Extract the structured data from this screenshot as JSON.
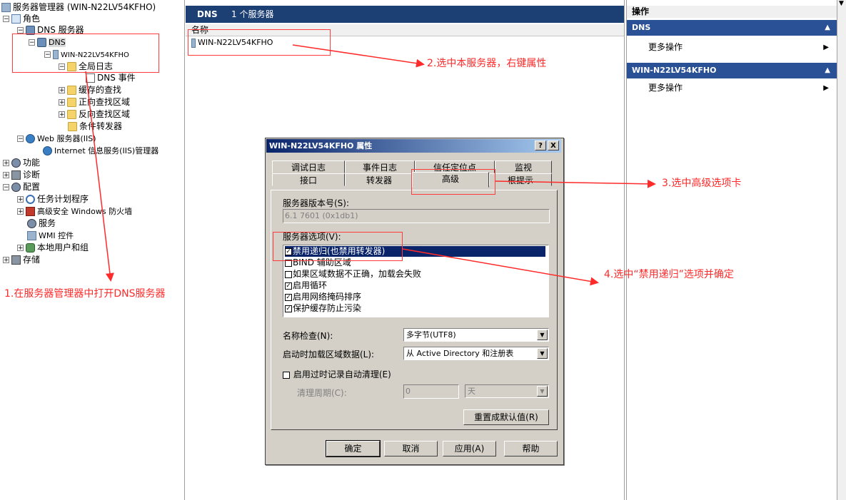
{
  "tree": {
    "root": "服务器管理器 (WIN-N22LV54KFHO)",
    "roles": "角色",
    "dns_server": "DNS 服务器",
    "dns": "DNS",
    "host": "WIN-N22LV54KFHO",
    "global_logs": "全局日志",
    "dns_events": "DNS 事件",
    "cached_lookups": "缓存的查找",
    "forward_zones": "正向查找区域",
    "reverse_zones": "反向查找区域",
    "conditional_forwarders": "条件转发器",
    "web_server": "Web 服务器(IIS)",
    "iis_manager": "Internet 信息服务(IIS)管理器",
    "features": "功能",
    "diagnostics": "诊断",
    "configuration": "配置",
    "task_scheduler": "任务计划程序",
    "firewall": "高级安全 Windows 防火墙",
    "services": "服务",
    "wmi": "WMI 控件",
    "local_users": "本地用户和组",
    "storage": "存储"
  },
  "center": {
    "header_name": "DNS",
    "header_count": "1 个服务器",
    "column_name": "名称",
    "server_row": "WIN-N22LV54KFHO"
  },
  "actions": {
    "title": "操作",
    "section1": "DNS",
    "more1": "更多操作",
    "section2": "WIN-N22LV54KFHO",
    "more2": "更多操作"
  },
  "dialog": {
    "title": "WIN-N22LV54KFHO 属性",
    "help_btn": "?",
    "close_btn": "X",
    "tabs_row1": [
      "调试日志",
      "事件日志",
      "信任定位点",
      "监视"
    ],
    "tabs_row2": [
      "接口",
      "转发器",
      "高级",
      "根提示"
    ],
    "version_label": "服务器版本号(S):",
    "version_value": "6.1 7601 (0x1db1)",
    "options_label": "服务器选项(V):",
    "options": [
      {
        "label": "禁用递归(也禁用转发器)",
        "checked": true
      },
      {
        "label": "BIND 辅助区域",
        "checked": false
      },
      {
        "label": "如果区域数据不正确，加载会失败",
        "checked": false
      },
      {
        "label": "启用循环",
        "checked": true
      },
      {
        "label": "启用网络掩码排序",
        "checked": true
      },
      {
        "label": "保护缓存防止污染",
        "checked": true
      }
    ],
    "name_check_label": "名称检查(N):",
    "name_check_value": "多字节(UTF8)",
    "load_label": "启动时加载区域数据(L):",
    "load_value": "从 Active Directory 和注册表",
    "scavenging_label": "启用过时记录自动清理(E)",
    "period_label": "清理周期(C):",
    "period_value": "0",
    "period_unit": "天",
    "reset_btn": "重置成默认值(R)",
    "ok_btn": "确定",
    "cancel_btn": "取消",
    "apply_btn": "应用(A)",
    "help_footer_btn": "帮助"
  },
  "annotations": {
    "note1": "1.在服务器管理器中打开DNS服务器",
    "note2": "2.选中本服务器，右键属性",
    "note3": "3.选中高级选项卡",
    "note4": "4.选中“禁用递归”选项并确定"
  },
  "colors": {
    "annotation": "#ff2a2a",
    "header_bar": "#1c3f74",
    "action_bar": "#2a5196",
    "dialog_face": "#d4d0c8",
    "selection": "#0a246a"
  }
}
